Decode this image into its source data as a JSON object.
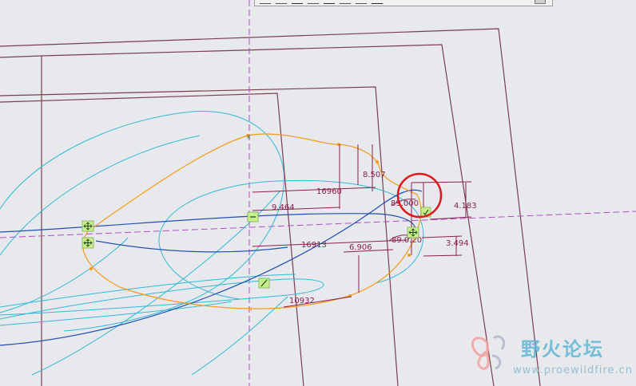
{
  "dimensions": {
    "d_8507": "8.507",
    "d_16960": "16960",
    "d_9464": "9.464",
    "d_89000": "89.000",
    "d_4183": "4.183",
    "d_89020": "89.0.20",
    "d_16913": "16913",
    "d_6906": "6.906",
    "d_3494": "3.494",
    "d_10932": "10932"
  },
  "watermark": {
    "title": "野火论坛",
    "url": "www.proewildfire.cn"
  },
  "colors": {
    "background": "#e8e9ec",
    "frame": "#7b3e4f",
    "spline_orange": "#f39a1a",
    "curve_cyan": "#30b9d6",
    "curve_blue": "#1f4fb5",
    "dimension": "#8a1f4c",
    "centerline": "#b04fc9",
    "highlight_circle": "#e0161c",
    "handle": "#c6f08a"
  },
  "icons": [
    "move-handle-icon",
    "dash-handle-icon",
    "slash-handle-icon",
    "checkmark-icon"
  ]
}
